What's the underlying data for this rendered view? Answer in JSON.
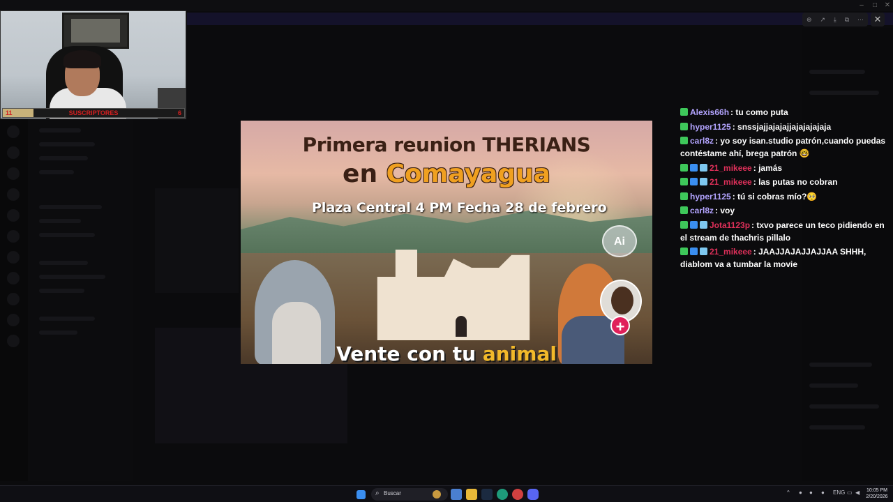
{
  "webcam": {
    "sub_count_left": "11",
    "sub_label": "SUSCRIPTORES",
    "sub_count_right": "6",
    "progress": 0.17
  },
  "viewer_tools": {
    "icons": [
      "zoom-icon",
      "share-icon",
      "download-icon",
      "open-external-icon",
      "more-icon"
    ],
    "close_icon": "close-icon"
  },
  "image": {
    "title_line1": "Primera reunion THERIANS",
    "title_line2_prefix": "en ",
    "title_line2_highlight": "Comayagua",
    "place_line": "Plaza Central 4 PM  Fecha 28 de febrero",
    "bottom_prefix": "Vente con tu ",
    "bottom_highlight": "animal",
    "ai_badge": "Ai",
    "plus": "+"
  },
  "chat": {
    "messages": [
      {
        "user": "Alexis66h",
        "text": ": tu como puta",
        "color": "#b3a4ff",
        "badges": 1
      },
      {
        "user": "hyper1125",
        "text": ": snssjajjajajajjajajajajaja",
        "color": "#b3a4ff",
        "badges": 1
      },
      {
        "user": "carl8z",
        "text": ": yo soy isan.studio patrón,cuando puedas contéstame ahí, brega patrón 🤓",
        "color": "#b3a4ff",
        "badges": 1
      },
      {
        "user": "21_mikeee",
        "text": ": jamás",
        "color": "#e0305a",
        "badges": 3
      },
      {
        "user": "21_mikeee",
        "text": ": las putas no cobran",
        "color": "#e0305a",
        "badges": 3
      },
      {
        "user": "hyper1125",
        "text": ": tú si cobras mío?🥺",
        "color": "#b3a4ff",
        "badges": 1
      },
      {
        "user": "carl8z",
        "text": ": voy",
        "color": "#b3a4ff",
        "badges": 1
      },
      {
        "user": "Jota1123p",
        "text": ": txvo parece un teco pidiendo en el stream de thachris pillalo",
        "color": "#e0305a",
        "badges": 3
      },
      {
        "user": "21_mikeee",
        "text": ": JAAJJAJAJJAJJAA SHHH, diablom va a tumbar la movie",
        "color": "#e0305a",
        "badges": 3
      }
    ]
  },
  "taskbar": {
    "search_placeholder": "Buscar",
    "language": "ENG",
    "time": "10:05 PM",
    "date": "2/20/2026"
  }
}
